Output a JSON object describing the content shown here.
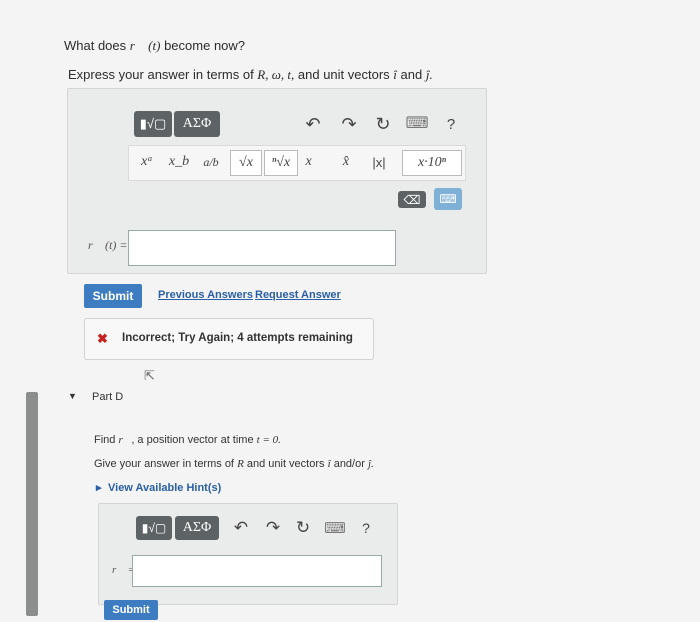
{
  "partC": {
    "question_prefix": "What does ",
    "question_math": "r⃗ (t)",
    "question_suffix": " become now?",
    "express_prefix": "Express your answer in terms of ",
    "express_vars": "R, ω, t,",
    "express_mid": " and unit vectors ",
    "unit_i": "î",
    "unit_and": " and ",
    "unit_j": "ĵ.",
    "toolbar": {
      "template_icon": "▮√▢",
      "greek_label": "ΑΣΦ",
      "undo_icon": "↶",
      "redo_icon": "↷",
      "reset_icon": "↻",
      "keyboard_icon": "⌨",
      "help_label": "?"
    },
    "math_buttons": [
      "xᵃ",
      "x_b",
      "a/b",
      "√x",
      "ⁿ√x",
      "x⃗",
      "x̂",
      "|x|",
      "x·10ⁿ"
    ],
    "delete_icon": "⌫",
    "answer_label": "r⃗ (t) =",
    "submit_label": "Submit",
    "previous_answers": "Previous Answers",
    "request_answer": "Request Answer",
    "feedback_icon": "✖",
    "feedback_text": "Incorrect; Try Again; 4 attempts remaining"
  },
  "partD": {
    "title": "Part D",
    "find_prefix": "Find ",
    "find_math": "r⃗",
    "find_mid": ", a position vector at time ",
    "find_time": "t = 0.",
    "give_prefix": "Give your answer in terms of ",
    "give_var": "R",
    "give_mid": " and unit vectors ",
    "give_i": "î",
    "give_andor": " and/or ",
    "give_j": "ĵ.",
    "hint_label": "View Available Hint(s)",
    "answer_label": "r⃗ =",
    "submit_label": "Submit"
  }
}
